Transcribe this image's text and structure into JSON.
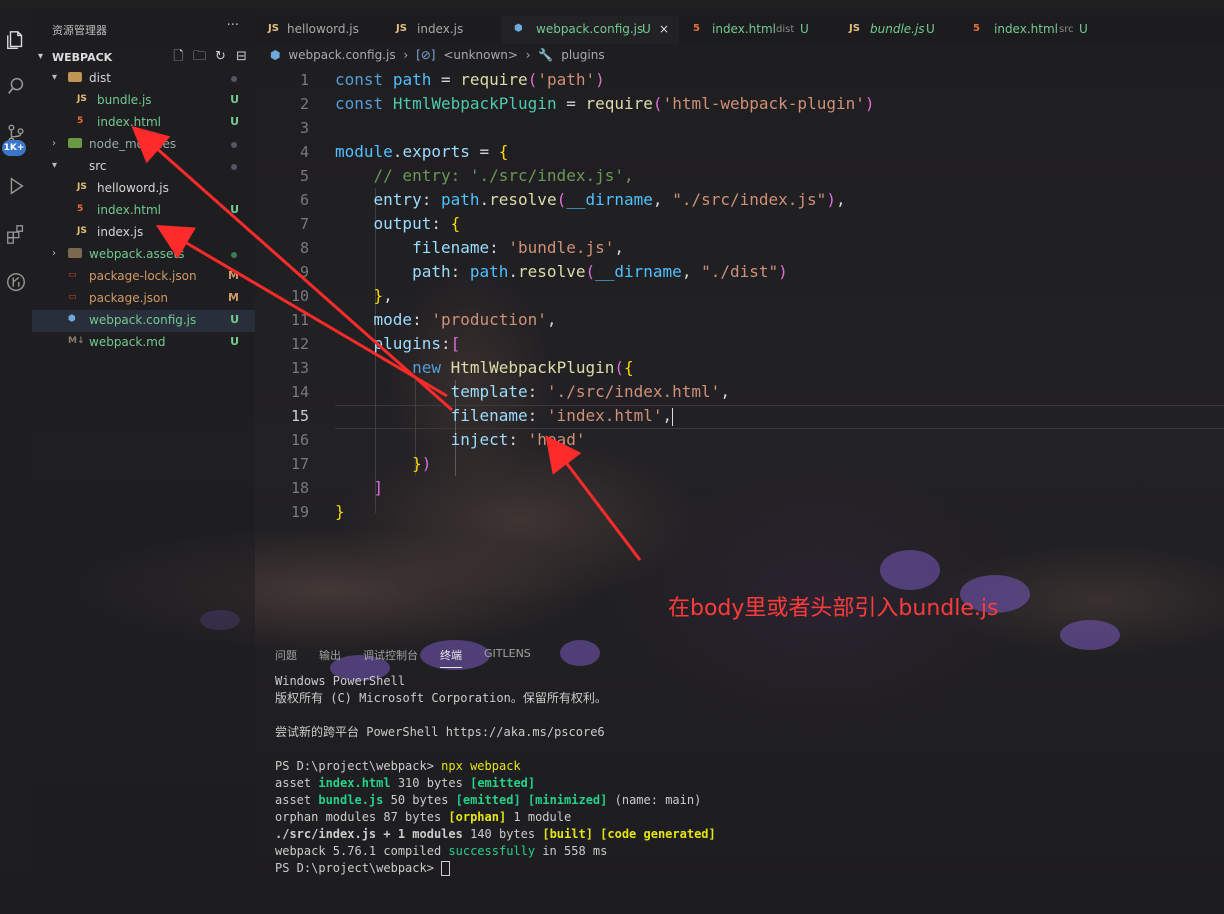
{
  "sidebar": {
    "title": "资源管理器",
    "more": "···",
    "section": "WEBPACK",
    "items": [
      {
        "name": "dist",
        "status": ""
      },
      {
        "name": "bundle.js",
        "status": "U"
      },
      {
        "name": "index.html",
        "status": "U"
      },
      {
        "name": "node_modules",
        "status": ""
      },
      {
        "name": "src",
        "status": ""
      },
      {
        "name": "helloword.js",
        "status": ""
      },
      {
        "name": "index.html",
        "status": "U"
      },
      {
        "name": "index.js",
        "status": ""
      },
      {
        "name": "webpack.assets",
        "status": ""
      },
      {
        "name": "package-lock.json",
        "status": "M"
      },
      {
        "name": "package.json",
        "status": "M"
      },
      {
        "name": "webpack.config.js",
        "status": "U"
      },
      {
        "name": "webpack.md",
        "status": "U"
      }
    ]
  },
  "activity": {
    "badge": "1K+"
  },
  "tabs": [
    {
      "icon": "JS",
      "label": "helloword.js",
      "dir": "",
      "status": ""
    },
    {
      "icon": "JS",
      "label": "index.js",
      "dir": "",
      "status": ""
    },
    {
      "icon": "cfg",
      "label": "webpack.config.js",
      "dir": "",
      "status": "U"
    },
    {
      "icon": "html",
      "label": "index.html",
      "dir": "dist",
      "status": "U"
    },
    {
      "icon": "JS",
      "label": "bundle.js",
      "dir": "",
      "status": "U"
    },
    {
      "icon": "html",
      "label": "index.html",
      "dir": "src",
      "status": "U"
    }
  ],
  "breadcrumb": [
    "webpack.config.js",
    "<unknown>",
    "plugins"
  ],
  "editor": {
    "line_numbers": [
      "1",
      "2",
      "3",
      "4",
      "5",
      "6",
      "7",
      "8",
      "9",
      "10",
      "11",
      "12",
      "13",
      "14",
      "15",
      "16",
      "17",
      "18",
      "19"
    ],
    "current_line": "15",
    "lines": [
      "const path = require('path')",
      "const HtmlWebpackPlugin = require('html-webpack-plugin')",
      "",
      "module.exports = {",
      "    // entry: './src/index.js',",
      "    entry: path.resolve(__dirname, \"./src/index.js\"),",
      "    output: {",
      "        filename: 'bundle.js',",
      "        path: path.resolve(__dirname, \"./dist\")",
      "    },",
      "    mode: 'production',",
      "    plugins:[",
      "        new HtmlWebpackPlugin({",
      "            template: './src/index.html',",
      "            filename: 'index.html',",
      "            inject: 'head'",
      "        })",
      "    ]",
      "}"
    ]
  },
  "annotation": "在body里或者头部引入bundle.js",
  "panel": {
    "tabs": [
      "问题",
      "输出",
      "调试控制台",
      "终端",
      "GITLENS"
    ],
    "active_tab": "终端",
    "terminal": {
      "l1": "Windows PowerShell",
      "l2": "版权所有 (C) Microsoft Corporation。保留所有权利。",
      "l3": "尝试新的跨平台 PowerShell https://aka.ms/pscore6",
      "prompt1": "PS D:\\project\\webpack> ",
      "cmd1": "npx webpack",
      "a1_pre": "asset ",
      "a1_file": "index.html",
      "a1_mid": " 310 bytes ",
      "a1_tag": "[emitted]",
      "a2_pre": "asset ",
      "a2_file": "bundle.js",
      "a2_mid": " 50 bytes ",
      "a2_tag1": "[emitted]",
      "a2_tag2": "[minimized]",
      "a2_post": " (name: main)",
      "o_pre": "orphan modules 87 bytes ",
      "o_tag": "[orphan]",
      "o_post": " 1 module",
      "s_path": "./src/index.js",
      "s_mid": " + 1 modules",
      "s_bytes": " 140 bytes ",
      "s_tag1": "[built]",
      "s_tag2": "[code generated]",
      "w_pre": "webpack 5.76.1 compiled ",
      "w_ok": "successfully",
      "w_post": " in 558 ms",
      "prompt2": "PS D:\\project\\webpack> "
    }
  },
  "colors": {
    "annotation": "#ff3b3b",
    "keyword": "#569cd6",
    "string": "#ce9178",
    "comment": "#6a9955"
  }
}
